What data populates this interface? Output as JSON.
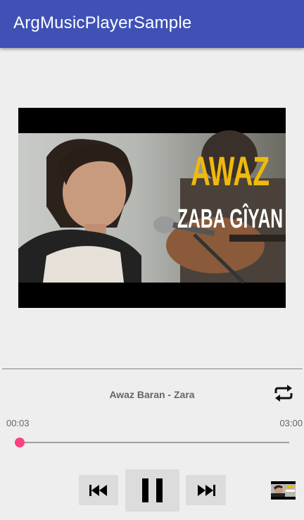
{
  "app": {
    "title": "ArgMusicPlayerSample"
  },
  "artwork": {
    "overlay_line1": "AWAZ",
    "overlay_line2": "ZABA GÎYAN"
  },
  "player": {
    "track_title": "Awaz Baran - Zara",
    "current_time": "00:03",
    "total_time": "03:00",
    "progress": 0.017,
    "state": "playing",
    "repeat_icon": "repeat-icon",
    "colors": {
      "app_bar": "#3f51b5",
      "accent": "#ff4081"
    }
  },
  "controls": {
    "prev_icon": "skip-previous-icon",
    "pause_icon": "pause-icon",
    "next_icon": "skip-next-icon"
  }
}
